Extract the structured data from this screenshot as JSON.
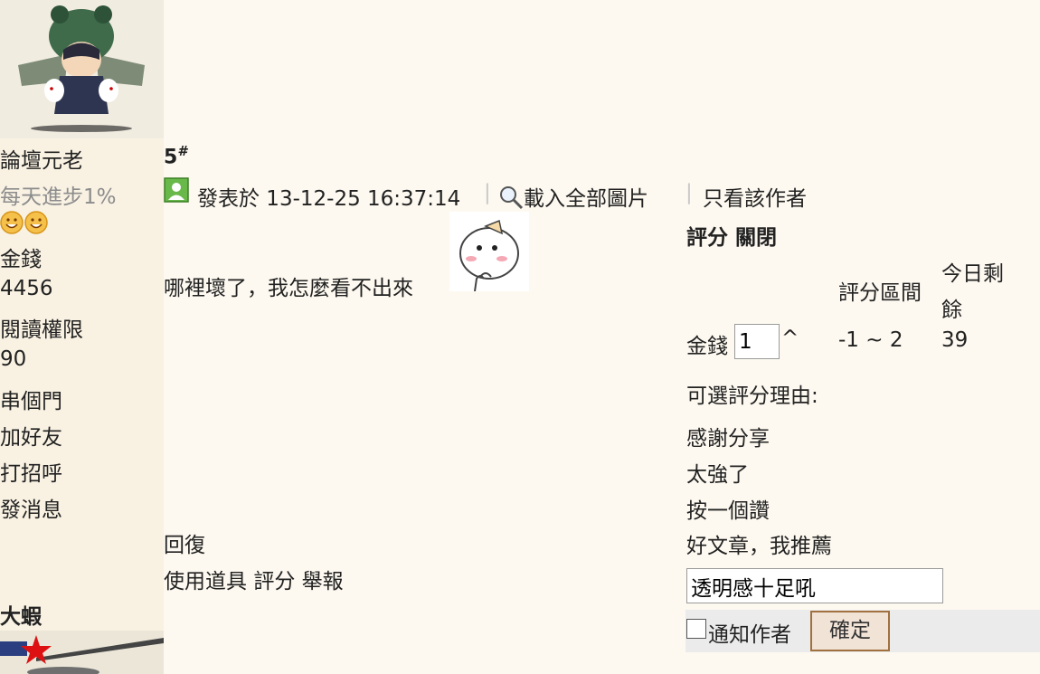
{
  "user": {
    "title": "論壇元老",
    "motto": "每天進步1%",
    "money_label": "金錢",
    "money_value": "4456",
    "read_label": "閱讀權限",
    "read_value": "90",
    "actions": [
      "串個門",
      "加好友",
      "打招呼",
      "發消息"
    ]
  },
  "next_user": {
    "name": "大蝦"
  },
  "post": {
    "floor": "5",
    "floor_sup": "#",
    "posted_at": "發表於 13-12-25 16:37:14",
    "load_images": "載入全部圖片",
    "only_author": "只看該作者",
    "content": "哪裡壞了，我怎麼看不出來",
    "reply": "回復",
    "tools": [
      "使用道具",
      "評分",
      "舉報"
    ]
  },
  "rate": {
    "header_rate": "評分",
    "header_close": "關閉",
    "col_range": "評分區間",
    "col_remain": "今日剩餘",
    "field_label": "金錢",
    "field_value": "1",
    "caret": "^",
    "range": "-1 ~ 2",
    "remain": "39",
    "reasons_label": "可選評分理由:",
    "reasons": [
      "感謝分享",
      "太強了",
      "按一個讚",
      "好文章，我推薦"
    ],
    "reason_input": "透明感十足吼",
    "notify_label": "通知作者",
    "confirm": "確定"
  },
  "colors": {
    "page_bg": "#fdf9f0",
    "sidebar_bg": "#f9f2e3",
    "motto": "#8c8c8c",
    "confirm_border": "#a0703f"
  }
}
